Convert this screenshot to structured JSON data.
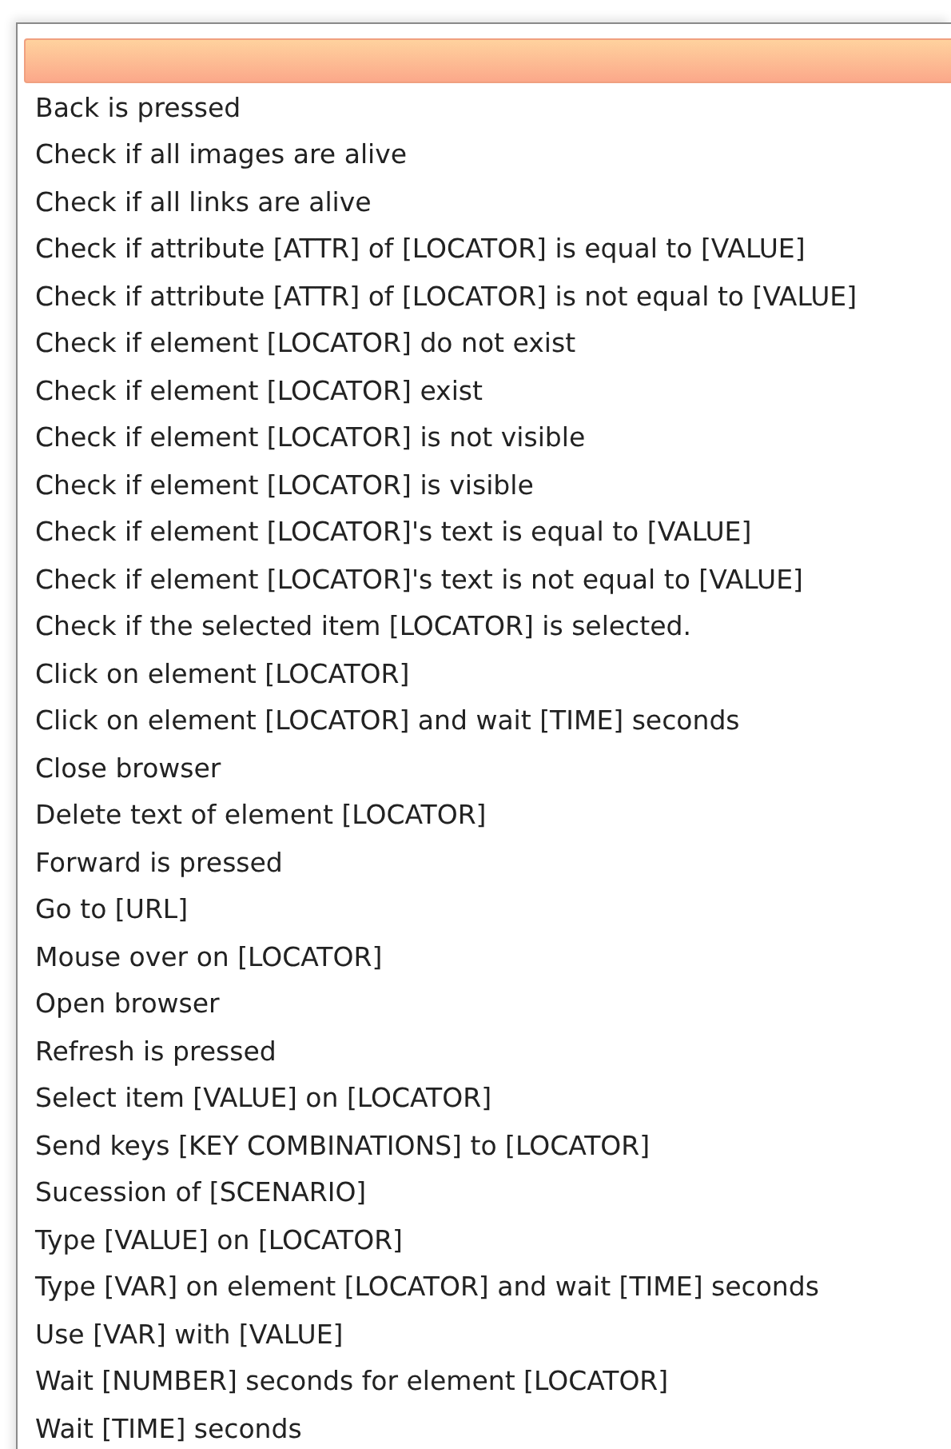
{
  "dropdown": {
    "options": [
      {
        "selected": true
      },
      {
        "label": "Back is pressed",
        "selected": false
      },
      {
        "label": "Check if all images are alive",
        "selected": false
      },
      {
        "label": "Check if all links are alive",
        "selected": false
      },
      {
        "label": "Check if attribute [ATTR] of [LOCATOR] is equal to [VALUE]",
        "selected": false
      },
      {
        "label": "Check if attribute [ATTR] of [LOCATOR] is not equal to [VALUE]",
        "selected": false
      },
      {
        "label": "Check if element [LOCATOR] do not exist",
        "selected": false
      },
      {
        "label": "Check if element [LOCATOR] exist",
        "selected": false
      },
      {
        "label": "Check if element [LOCATOR] is not visible",
        "selected": false
      },
      {
        "label": "Check if element [LOCATOR] is visible",
        "selected": false
      },
      {
        "label": "Check if element [LOCATOR]'s text is equal to [VALUE]",
        "selected": false
      },
      {
        "label": "Check if element [LOCATOR]'s text is not equal to [VALUE]",
        "selected": false
      },
      {
        "label": "Check if the selected item [LOCATOR] is selected.",
        "selected": false
      },
      {
        "label": "Click on element [LOCATOR]",
        "selected": false
      },
      {
        "label": "Click on element [LOCATOR] and wait [TIME] seconds",
        "selected": false
      },
      {
        "label": "Close browser",
        "selected": false
      },
      {
        "label": "Delete text of element [LOCATOR]",
        "selected": false
      },
      {
        "label": "Forward is pressed",
        "selected": false
      },
      {
        "label": "Go to [URL]",
        "selected": false
      },
      {
        "label": "Mouse over on [LOCATOR]",
        "selected": false
      },
      {
        "label": "Open browser",
        "selected": false
      },
      {
        "label": "Refresh is pressed",
        "selected": false
      },
      {
        "label": "Select item [VALUE] on [LOCATOR]",
        "selected": false
      },
      {
        "label": "Send keys [KEY COMBINATIONS] to [LOCATOR]",
        "selected": false
      },
      {
        "label": "Sucession of [SCENARIO]",
        "selected": false
      },
      {
        "label": "Type [VALUE] on [LOCATOR]",
        "selected": false
      },
      {
        "label": "Type [VAR] on element [LOCATOR] and wait [TIME] seconds",
        "selected": false
      },
      {
        "label": "Use [VAR] with [VALUE]",
        "selected": false
      },
      {
        "label": "Wait [NUMBER] seconds for element [LOCATOR]",
        "selected": false
      },
      {
        "label": "Wait [TIME] seconds",
        "selected": false
      }
    ]
  }
}
